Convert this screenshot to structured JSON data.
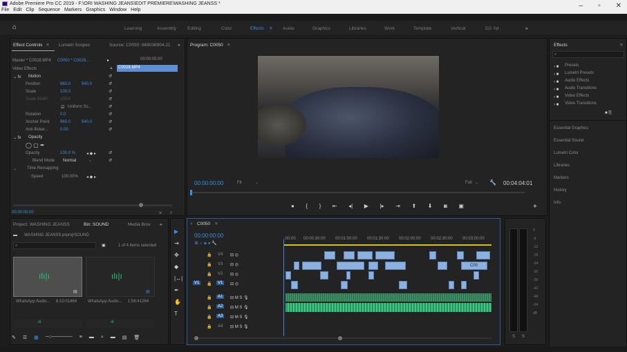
{
  "app": {
    "title": "Adobe Premiere Pro CC 2019 - F:\\ORI WASHING JEANS\\EDIT PREMIERE\\WASHING JEANSS *",
    "menu": [
      "File",
      "Edit",
      "Clip",
      "Sequence",
      "Markers",
      "Graphics",
      "Window",
      "Help"
    ]
  },
  "workspaces": [
    "Learning",
    "Assembly",
    "Editing",
    "Color",
    "Effects",
    "Audio",
    "Graphics",
    "Libraries",
    "Work",
    "Template",
    "Vertical",
    "D2- hd"
  ],
  "workspace_active": "Effects",
  "effect_controls": {
    "tabs": [
      "Effect Controls",
      "Lumetri Scopes",
      "Source: C0050: 669036904.21"
    ],
    "master": "Master * C0028.MP4",
    "sequence": "C0050 * C0028...",
    "clip_label": "C0028.MP4",
    "timecode_top": "00:00:05:00",
    "section": "Video Effects",
    "motion": "Motion",
    "position_label": "Position",
    "position_x": "960.0",
    "position_y": "540.0",
    "scale_label": "Scale",
    "scale_val": "100.0",
    "scale_width_label": "Scale Width",
    "scale_width_val": "100.0",
    "uniform": "Uniform Sc...",
    "rotation_label": "Rotation",
    "rotation_val": "0.0",
    "anchor_label": "Anchor Point",
    "anchor_x": "960.0",
    "anchor_y": "540.0",
    "antiflicker_label": "Anti-flicker...",
    "antiflicker_val": "0.00",
    "opacity": "Opacity",
    "opacity_label": "Opacity",
    "opacity_val": "100.0 %",
    "blend_label": "Blend Mode",
    "blend_val": "Normal",
    "time_remap": "Time Remapping",
    "speed_label": "Speed",
    "speed_val": "100.00%",
    "timecode_bottom": "00:00:00:00"
  },
  "program": {
    "tab": "Program: C0050",
    "timecode": "00:00:00:00",
    "fit": "Fit",
    "quality": "Full",
    "duration": "00:04:04:01"
  },
  "project": {
    "tabs": [
      "Project: WASHING JEANSS",
      "Bin: SOUND",
      "Media Brov"
    ],
    "path": "WASHING JEANSS.prproj\\SOUND",
    "count": "1 of 4 items selected",
    "items": [
      {
        "name": "WhatsApp Audio...",
        "duration": "6:10:01464"
      },
      {
        "name": "WhatsApp Audio...",
        "duration": "1:56:41264"
      }
    ]
  },
  "timeline": {
    "tab": "C0050",
    "timecode": "00:00:00:00",
    "ruler": [
      ":00:00",
      "00:00:30:00",
      "00:01:00:00",
      "00:01:30:00",
      "00:02:00:00",
      "00:02:30:00",
      "00:03:00:00"
    ],
    "tracks": [
      "V4",
      "V3",
      "V2",
      "V1",
      "A1",
      "A2",
      "A3",
      "A4"
    ],
    "clip_label": "C00"
  },
  "effects_panel": {
    "title": "Effects",
    "items": [
      "Presets",
      "Lumetri Presets",
      "Audio Effects",
      "Audio Transitions",
      "Video Effects",
      "Video Transitions"
    ],
    "sections": [
      "Essential Graphics",
      "Essential Sound",
      "Lumetri Color",
      "Libraries",
      "Markers",
      "History",
      "Info"
    ]
  },
  "meter_labels": [
    "0",
    "-6",
    "-12",
    "-18",
    "-24",
    "-30",
    "-36",
    "-42",
    "-48",
    "-54",
    "dB"
  ],
  "meter_solo": [
    "S",
    "S"
  ]
}
